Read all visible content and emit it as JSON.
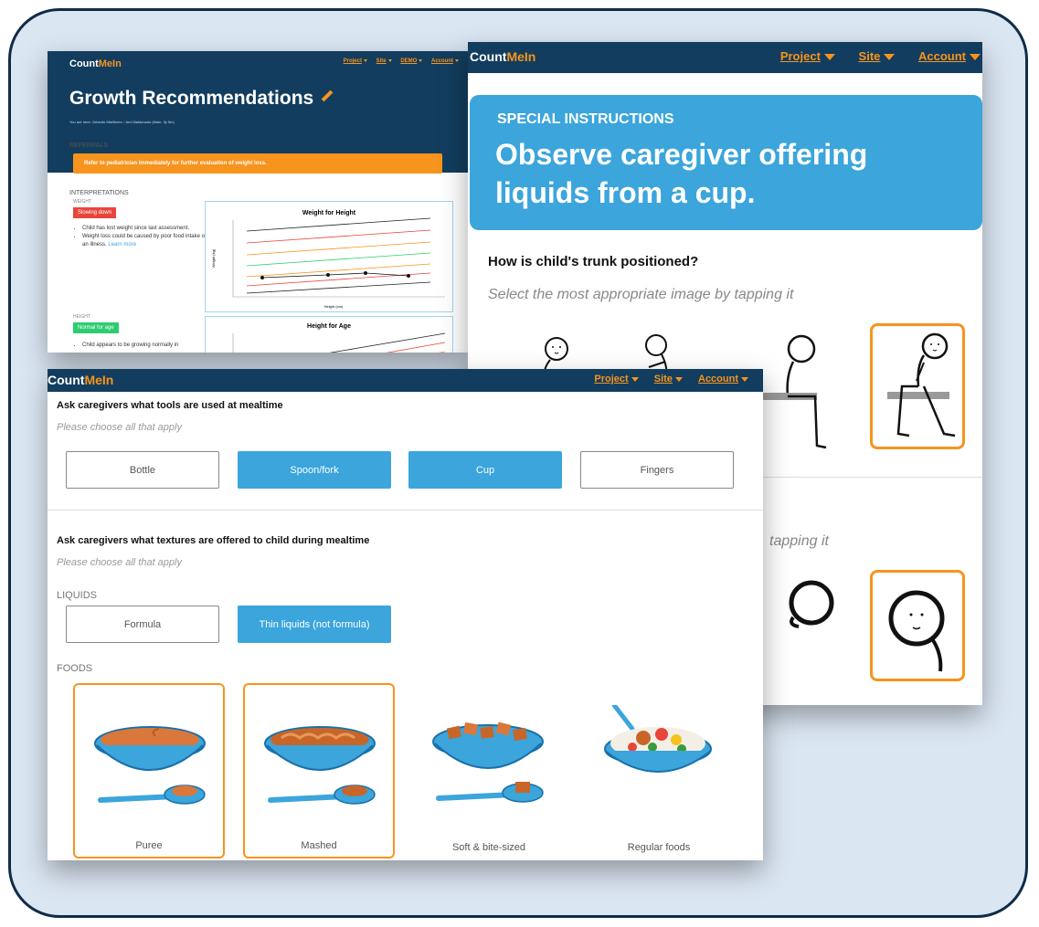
{
  "brand": {
    "prefix": "Count",
    "suffix": "MeIn"
  },
  "colors": {
    "navy": "#123d5e",
    "orange": "#f7941d",
    "blue": "#3ba5dc",
    "frame_bg": "#dbe6f3"
  },
  "growth": {
    "nav": [
      "Project",
      "Site",
      "DEMO",
      "Account"
    ],
    "title": "Growth Recommendations",
    "crumb": "You are here: Orlando Mistflores  ›  Jeni Maldonado (Male, 3y 5m)",
    "referrals_label": "REFERRALS",
    "referral_alert": "Refer to pediatrician immediately for further evaluation of weight loss.",
    "interpretations_label": "INTERPRETATIONS",
    "weight_label": "WEIGHT",
    "weight_tag": "Slowing down",
    "weight_bullets": [
      "Child has lost weight since last assessment.",
      "Weight loss could be caused by poor food intake or an illness."
    ],
    "learn_more": "Learn more",
    "height_label": "HEIGHT",
    "height_tag": "Normal for age",
    "height_bullet": "Child appears to be growing normally in",
    "chart1_title": "Weight for Height",
    "chart1_xlabel": "Height (cm)",
    "chart1_ylabel": "Weight (kg)",
    "chart2_title": "Height for Age"
  },
  "instructions": {
    "nav": [
      "Project",
      "Site",
      "Account"
    ],
    "label": "SPECIAL INSTRUCTIONS",
    "title": "Observe caregiver offering liquids from a cup.",
    "question": "How is child's trunk positioned?",
    "hint": "Select the most appropriate image by tapping it",
    "hint_partial": "tapping it"
  },
  "mealtime": {
    "nav": [
      "Project",
      "Site",
      "Account"
    ],
    "tools_question": "Ask caregivers what tools are used at mealtime",
    "tools_hint": "Please choose all that apply",
    "tools": [
      {
        "label": "Bottle",
        "selected": false
      },
      {
        "label": "Spoon/fork",
        "selected": true
      },
      {
        "label": "Cup",
        "selected": true
      },
      {
        "label": "Fingers",
        "selected": false
      }
    ],
    "textures_question": "Ask caregivers what textures are offered to child during mealtime",
    "textures_hint": "Please choose all that apply",
    "liquids_label": "LIQUIDS",
    "liquids": [
      {
        "label": "Formula",
        "selected": false
      },
      {
        "label": "Thin liquids (not formula)",
        "selected": true
      }
    ],
    "foods_label": "FOODS",
    "foods": [
      {
        "label": "Puree",
        "selected": true
      },
      {
        "label": "Mashed",
        "selected": true
      },
      {
        "label": "Soft & bite-sized",
        "selected": false
      },
      {
        "label": "Regular foods",
        "selected": false
      }
    ]
  }
}
